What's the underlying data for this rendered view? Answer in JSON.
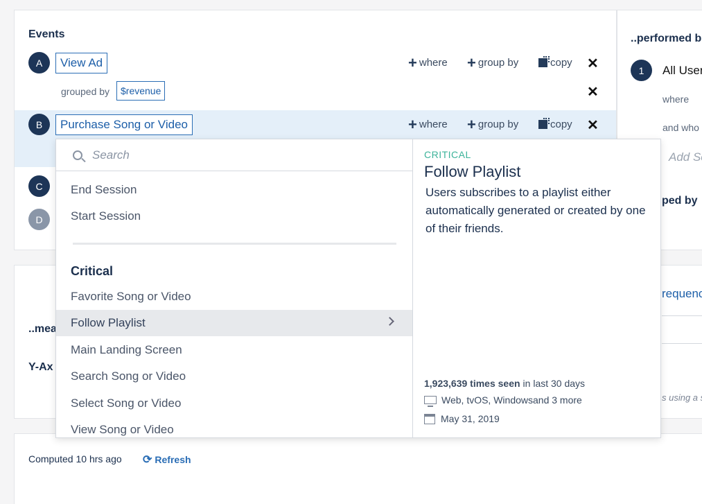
{
  "events": {
    "heading": "Events",
    "rows": [
      {
        "letter": "A",
        "event": "View Ad"
      },
      {
        "letter": "B",
        "event": "Purchase Song or Video"
      },
      {
        "letter": "C"
      },
      {
        "letter": "D"
      }
    ],
    "grouped_by_label": "grouped by",
    "grouped_by_value": "$revenue",
    "actions": {
      "where": "where",
      "group_by": "group by",
      "copy": "copy"
    }
  },
  "right_panel": {
    "heading": "..performed b",
    "step_number": "1",
    "all_users": "All User",
    "where": "where",
    "and_who": "and who",
    "add_segment": "Add Se",
    "grouped_by": "ped by"
  },
  "measures": {
    "heading": "..mea",
    "y_axis": "Y-Ax",
    "right_frequency": "requenc",
    "right_note": "s using a s"
  },
  "dropdown": {
    "search_placeholder": "Search",
    "items_top": [
      "End Session",
      "Start Session"
    ],
    "group_label": "Critical",
    "items": [
      "Favorite Song or Video",
      "Follow Playlist",
      "Main Landing Screen",
      "Search Song or Video",
      "Select Song or Video",
      "View Song or Video"
    ],
    "selected": "Follow Playlist"
  },
  "detail": {
    "label": "CRITICAL",
    "title": "Follow Playlist",
    "description": "Users subscribes to a playlist either automatically generated or created by one of their friends.",
    "times_seen": "1,923,639 times seen",
    "times_seen_suffix": "in last 30 days",
    "platforms": "Web, tvOS, Windowsand 3 more",
    "date": "May 31, 2019"
  },
  "footer": {
    "computed": "Computed 10 hrs ago",
    "refresh": "Refresh"
  }
}
